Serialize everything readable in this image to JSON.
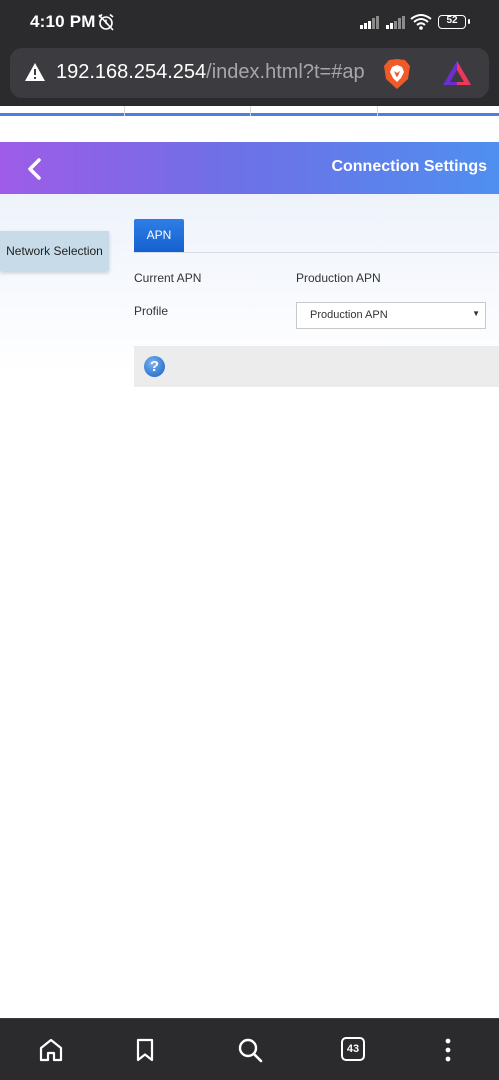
{
  "status_bar": {
    "time": "4:10 PM",
    "battery": "52"
  },
  "browser": {
    "url_host": "192.168.254.254",
    "url_rest": "/index.html?t=#ap",
    "tab_count": "43"
  },
  "header": {
    "title": "Connection Settings"
  },
  "sidebar": {
    "items": [
      {
        "label": "Network Selection"
      }
    ]
  },
  "main": {
    "tabs": [
      {
        "label": "APN"
      }
    ],
    "current_apn_label": "Current APN",
    "current_apn_value": "Production APN",
    "profile_label": "Profile",
    "profile_selected": "Production APN"
  },
  "colors": {
    "header_gradient_start": "#9e5ce8",
    "header_gradient_end": "#4f8ff0",
    "tab_active": "#1560cf",
    "sidebar_item_bg": "#c7dbe8"
  }
}
